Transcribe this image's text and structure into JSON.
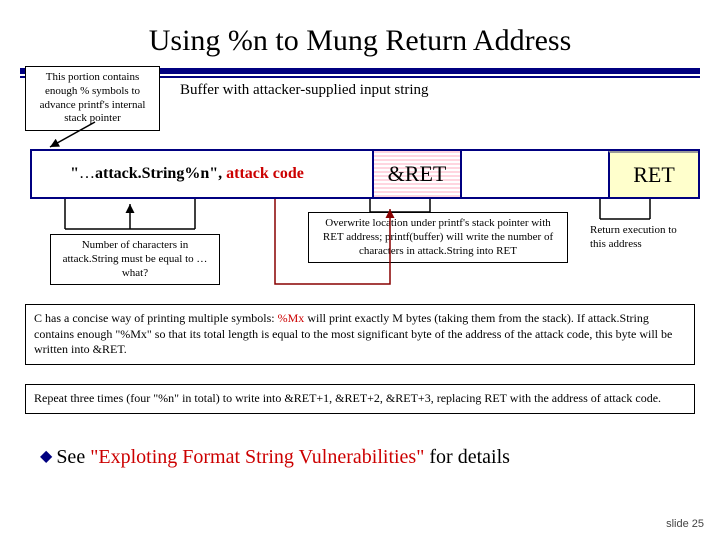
{
  "title": "Using %n to Mung Return Address",
  "callouts": {
    "top": "This portion contains enough % symbols to advance printf's internal stack pointer",
    "buffer_label": "Buffer with attacker-supplied input string",
    "bottom1": "Number of characters in attack.String must be equal to … what?",
    "bottom2": "Overwrite location under printf's stack pointer with RET address; printf(buffer) will write the number of characters in attack.String into RET",
    "bottom3": "Return execution to this address"
  },
  "stack": {
    "input_prefix": "\"",
    "input_dots": "…",
    "input_attack": "attack.String",
    "input_pct": "%n\", ",
    "input_code": "attack code",
    "ret1": "&RET",
    "ret2": "RET"
  },
  "para1_a": "C has a concise way of printing multiple symbols: ",
  "para1_hl": "%Mx",
  "para1_b": " will print exactly M bytes (taking them from the stack). If attack.String contains enough \"%Mx\" so that its total length is equal to the most significant byte of the address of the attack code, this byte will be written into &RET.",
  "para2": "Repeat three times (four \"%n\" in total) to write into &RET+1, &RET+2, &RET+3, replacing RET with the address of attack code.",
  "bullet_a": "See ",
  "bullet_hl": "\"Exploting Format String Vulnerabilities\"",
  "bullet_b": " for details",
  "slidenum": "slide 25"
}
